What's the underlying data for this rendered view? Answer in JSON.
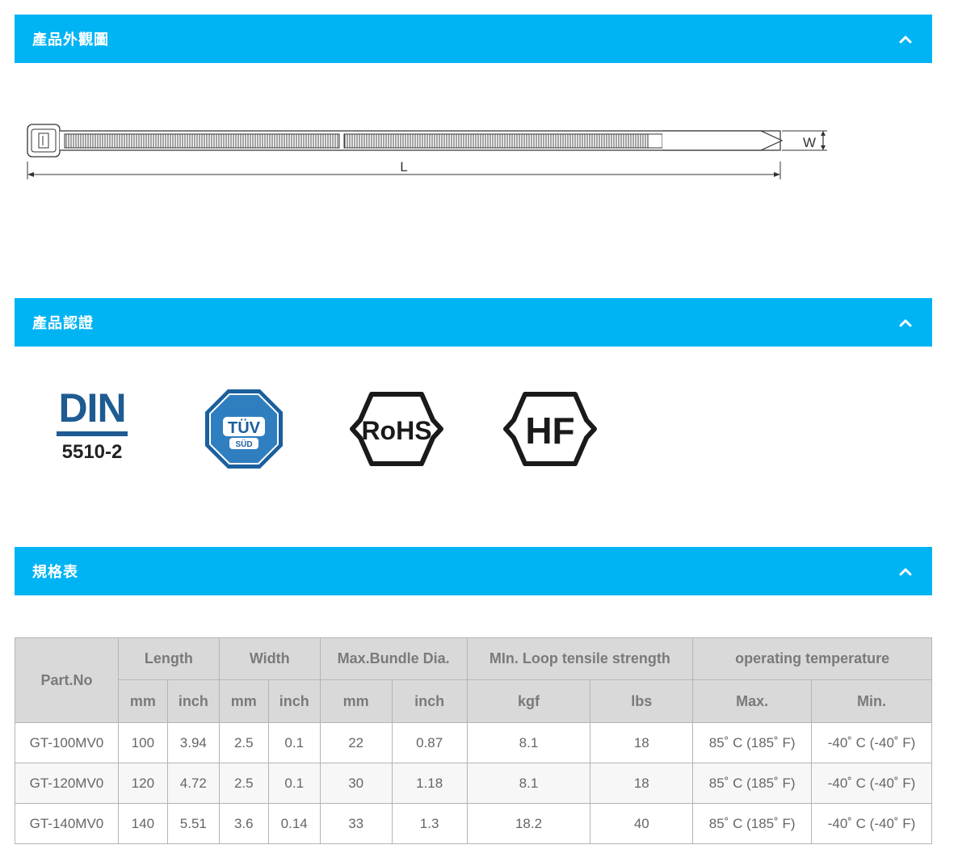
{
  "sections": {
    "appearance": {
      "title": "產品外觀圖"
    },
    "certification": {
      "title": "產品認證"
    },
    "spec": {
      "title": "規格表"
    }
  },
  "drawing": {
    "width_label": "W",
    "length_label": "L"
  },
  "certs": {
    "din": {
      "name": "DIN",
      "number": "5510-2"
    },
    "tuv": {
      "line1": "TÜV",
      "line2": "SÜD"
    },
    "rohs": {
      "name": "RoHS"
    },
    "hf": {
      "name": "HF"
    }
  },
  "table": {
    "headers": {
      "part_no": "Part.No",
      "length": "Length",
      "width": "Width",
      "bundle": "Max.Bundle Dia.",
      "loop": "MIn. Loop tensile strength",
      "temp": "operating temperature",
      "mm": "mm",
      "inch": "inch",
      "kgf": "kgf",
      "lbs": "lbs",
      "max": "Max.",
      "min": "Min."
    },
    "rows": [
      {
        "part": "GT-100MV0",
        "len_mm": "100",
        "len_in": "3.94",
        "w_mm": "2.5",
        "w_in": "0.1",
        "b_mm": "22",
        "b_in": "0.87",
        "kgf": "8.1",
        "lbs": "18",
        "tmax": "85˚ C (185˚ F)",
        "tmin": "-40˚ C (-40˚ F)"
      },
      {
        "part": "GT-120MV0",
        "len_mm": "120",
        "len_in": "4.72",
        "w_mm": "2.5",
        "w_in": "0.1",
        "b_mm": "30",
        "b_in": "1.18",
        "kgf": "8.1",
        "lbs": "18",
        "tmax": "85˚ C (185˚ F)",
        "tmin": "-40˚ C (-40˚ F)"
      },
      {
        "part": "GT-140MV0",
        "len_mm": "140",
        "len_in": "5.51",
        "w_mm": "3.6",
        "w_in": "0.14",
        "b_mm": "33",
        "b_in": "1.3",
        "kgf": "18.2",
        "lbs": "40",
        "tmax": "85˚ C (185˚ F)",
        "tmin": "-40˚ C (-40˚ F)"
      }
    ]
  },
  "colors": {
    "header_bg": "#00b4f4",
    "din_blue": "#1e5b92",
    "tuv_blue": "#1a6aa8"
  }
}
